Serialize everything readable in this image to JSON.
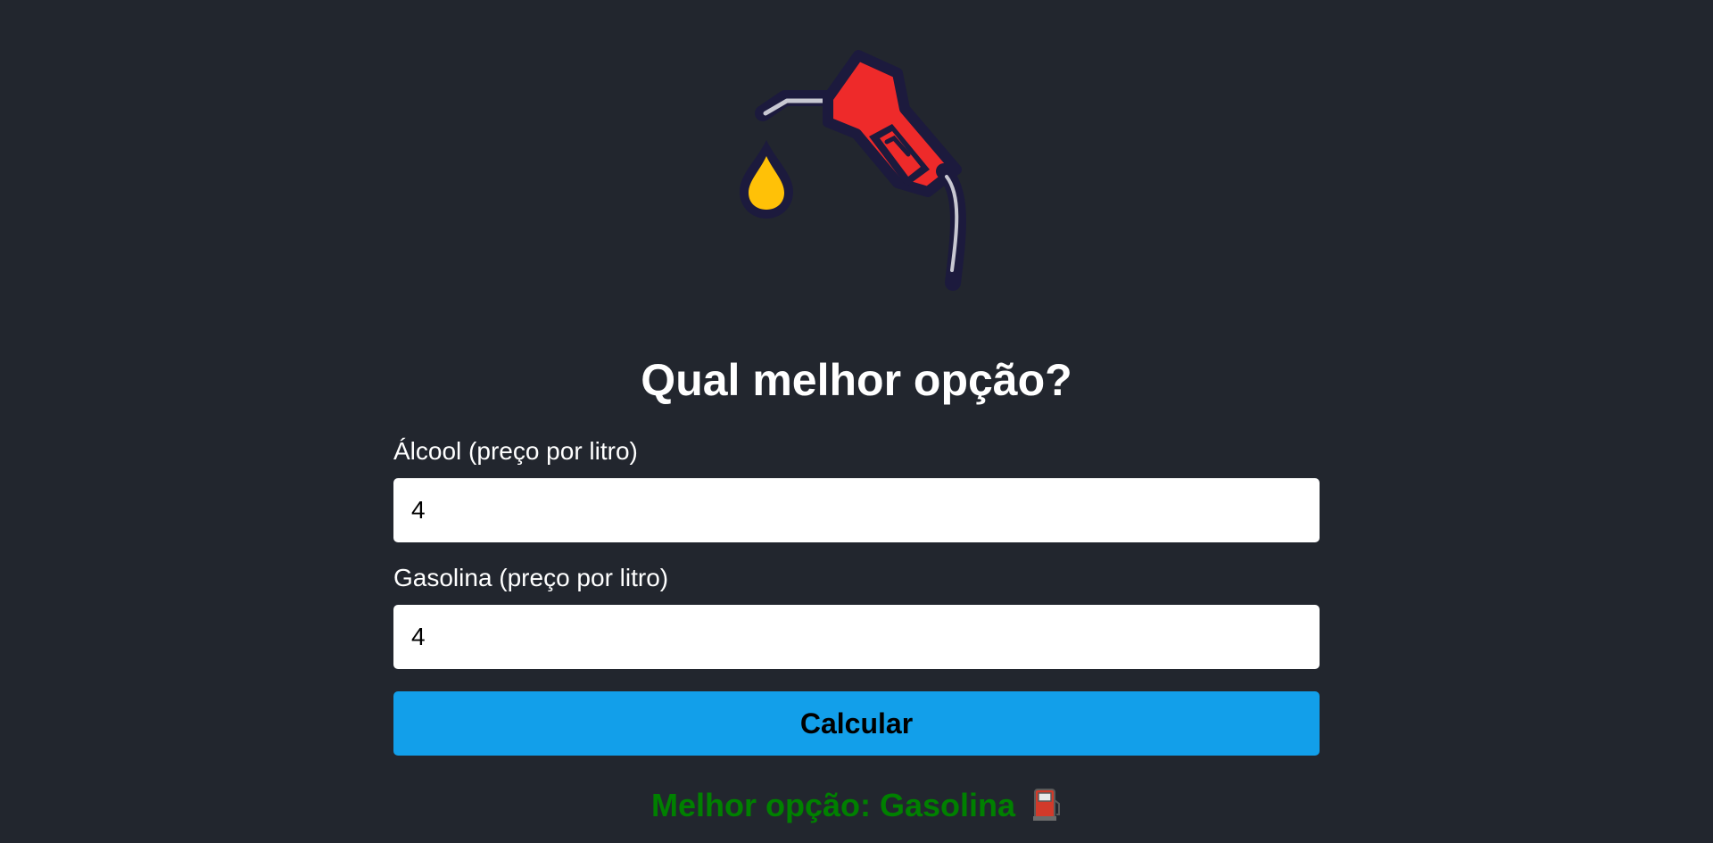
{
  "header": {
    "logo_icon": "fuel-nozzle-drop-icon",
    "title": "Qual melhor opção?"
  },
  "form": {
    "alcohol": {
      "label": "Álcool (preço por litro)",
      "value": "4"
    },
    "gasoline": {
      "label": "Gasolina (preço por litro)",
      "value": "4"
    },
    "submit_label": "Calcular"
  },
  "result": {
    "text": "Melhor opção: Gasolina",
    "icon": "fuel-pump-icon"
  },
  "colors": {
    "background": "#22262e",
    "button": "#129fea",
    "result_text": "#008000",
    "nozzle": "#ee2a2a",
    "drop": "#ffc107"
  }
}
